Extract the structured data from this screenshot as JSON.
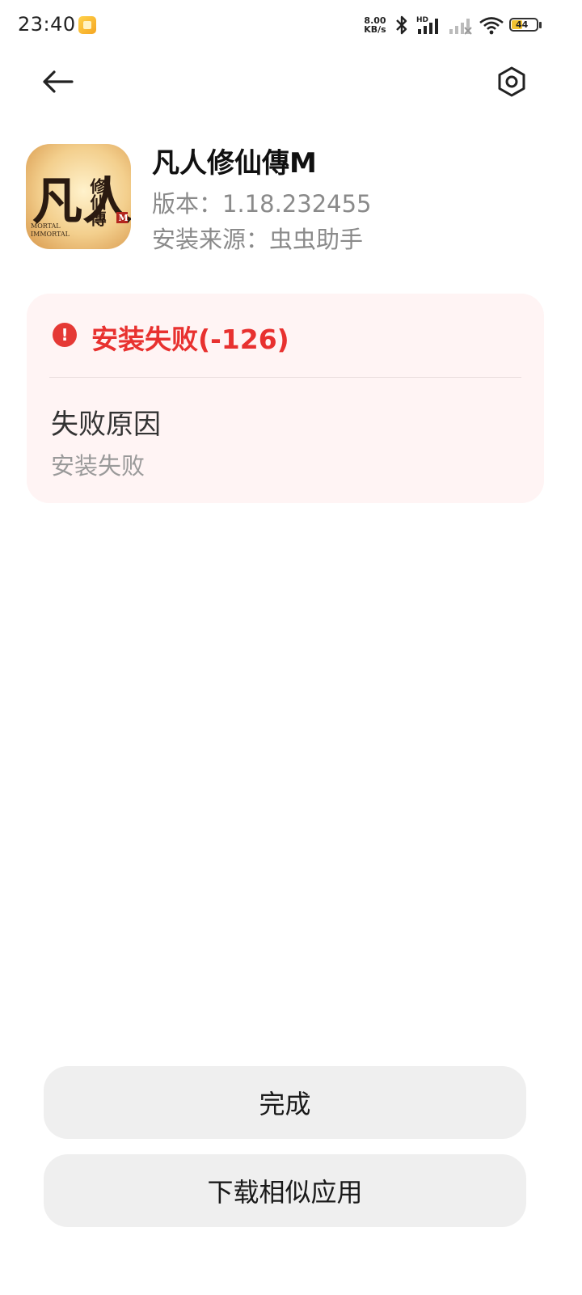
{
  "status_bar": {
    "time": "23:40",
    "speed_value": "8.00",
    "speed_unit": "KB/s",
    "battery_level": "44",
    "icons": [
      "notification-app-icon",
      "bluetooth-icon",
      "hd-signal-icon",
      "signal-icon",
      "wifi-icon",
      "battery-icon"
    ]
  },
  "top_bar": {
    "back_icon": "back-arrow-icon",
    "settings_icon": "hex-settings-icon"
  },
  "app": {
    "name": "凡人修仙傳M",
    "version_line": "版本：1.18.232455",
    "source_line": "安装来源：虫虫助手",
    "icon_text": "凡人",
    "icon_sub_text": "修仙傳",
    "icon_caption_1": "MORTAL",
    "icon_caption_2": "IMMORTAL",
    "icon_badge": "M"
  },
  "error_card": {
    "title": "安装失败(-126)",
    "reason_label": "失败原因",
    "reason_value": "安装失败",
    "accent_color": "#e8312f"
  },
  "buttons": {
    "done_label": "完成",
    "similar_label": "下载相似应用"
  }
}
